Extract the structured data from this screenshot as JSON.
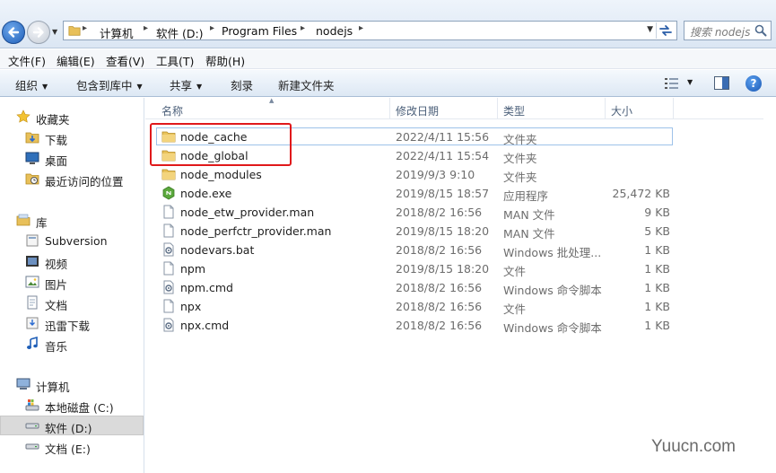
{
  "address": {
    "breadcrumbs": [
      "计算机",
      "软件 (D:)",
      "Program Files",
      "nodejs"
    ],
    "search_placeholder": "搜索 nodejs"
  },
  "menu": [
    "文件(F)",
    "编辑(E)",
    "查看(V)",
    "工具(T)",
    "帮助(H)"
  ],
  "commands": {
    "organize": "组织",
    "include_library": "包含到库中",
    "share": "共享",
    "burn": "刻录",
    "new_folder": "新建文件夹"
  },
  "nav": {
    "favorites": "收藏夹",
    "downloads": "下载",
    "desktop": "桌面",
    "recent": "最近访问的位置",
    "libraries": "库",
    "subversion": "Subversion",
    "videos": "视频",
    "pictures": "图片",
    "documents": "文档",
    "xunlei": "迅雷下载",
    "music": "音乐",
    "computer": "计算机",
    "drive_c": "本地磁盘 (C:)",
    "drive_d": "软件 (D:)",
    "drive_e": "文档 (E:)"
  },
  "columns": {
    "name": "名称",
    "date": "修改日期",
    "type": "类型",
    "size": "大小"
  },
  "files": [
    {
      "name": "node_cache",
      "date": "2022/4/11 15:56",
      "type": "文件夹",
      "size": "",
      "icon": "folder-icon"
    },
    {
      "name": "node_global",
      "date": "2022/4/11 15:54",
      "type": "文件夹",
      "size": "",
      "icon": "folder-icon"
    },
    {
      "name": "node_modules",
      "date": "2019/9/3 9:10",
      "type": "文件夹",
      "size": "",
      "icon": "folder-icon"
    },
    {
      "name": "node.exe",
      "date": "2019/8/15 18:57",
      "type": "应用程序",
      "size": "25,472 KB",
      "icon": "node-exe-icon"
    },
    {
      "name": "node_etw_provider.man",
      "date": "2018/8/2 16:56",
      "type": "MAN 文件",
      "size": "9 KB",
      "icon": "file-icon"
    },
    {
      "name": "node_perfctr_provider.man",
      "date": "2019/8/15 18:20",
      "type": "MAN 文件",
      "size": "5 KB",
      "icon": "file-icon"
    },
    {
      "name": "nodevars.bat",
      "date": "2018/8/2 16:56",
      "type": "Windows 批处理...",
      "size": "1 KB",
      "icon": "script-icon"
    },
    {
      "name": "npm",
      "date": "2019/8/15 18:20",
      "type": "文件",
      "size": "1 KB",
      "icon": "file-icon"
    },
    {
      "name": "npm.cmd",
      "date": "2018/8/2 16:56",
      "type": "Windows 命令脚本",
      "size": "1 KB",
      "icon": "script-icon"
    },
    {
      "name": "npx",
      "date": "2018/8/2 16:56",
      "type": "文件",
      "size": "1 KB",
      "icon": "file-icon"
    },
    {
      "name": "npx.cmd",
      "date": "2018/8/2 16:56",
      "type": "Windows 命令脚本",
      "size": "1 KB",
      "icon": "script-icon"
    }
  ],
  "watermark": "Yuucn.com",
  "colors": {
    "highlight": "#e0191b",
    "accent": "#1f5fb8"
  }
}
